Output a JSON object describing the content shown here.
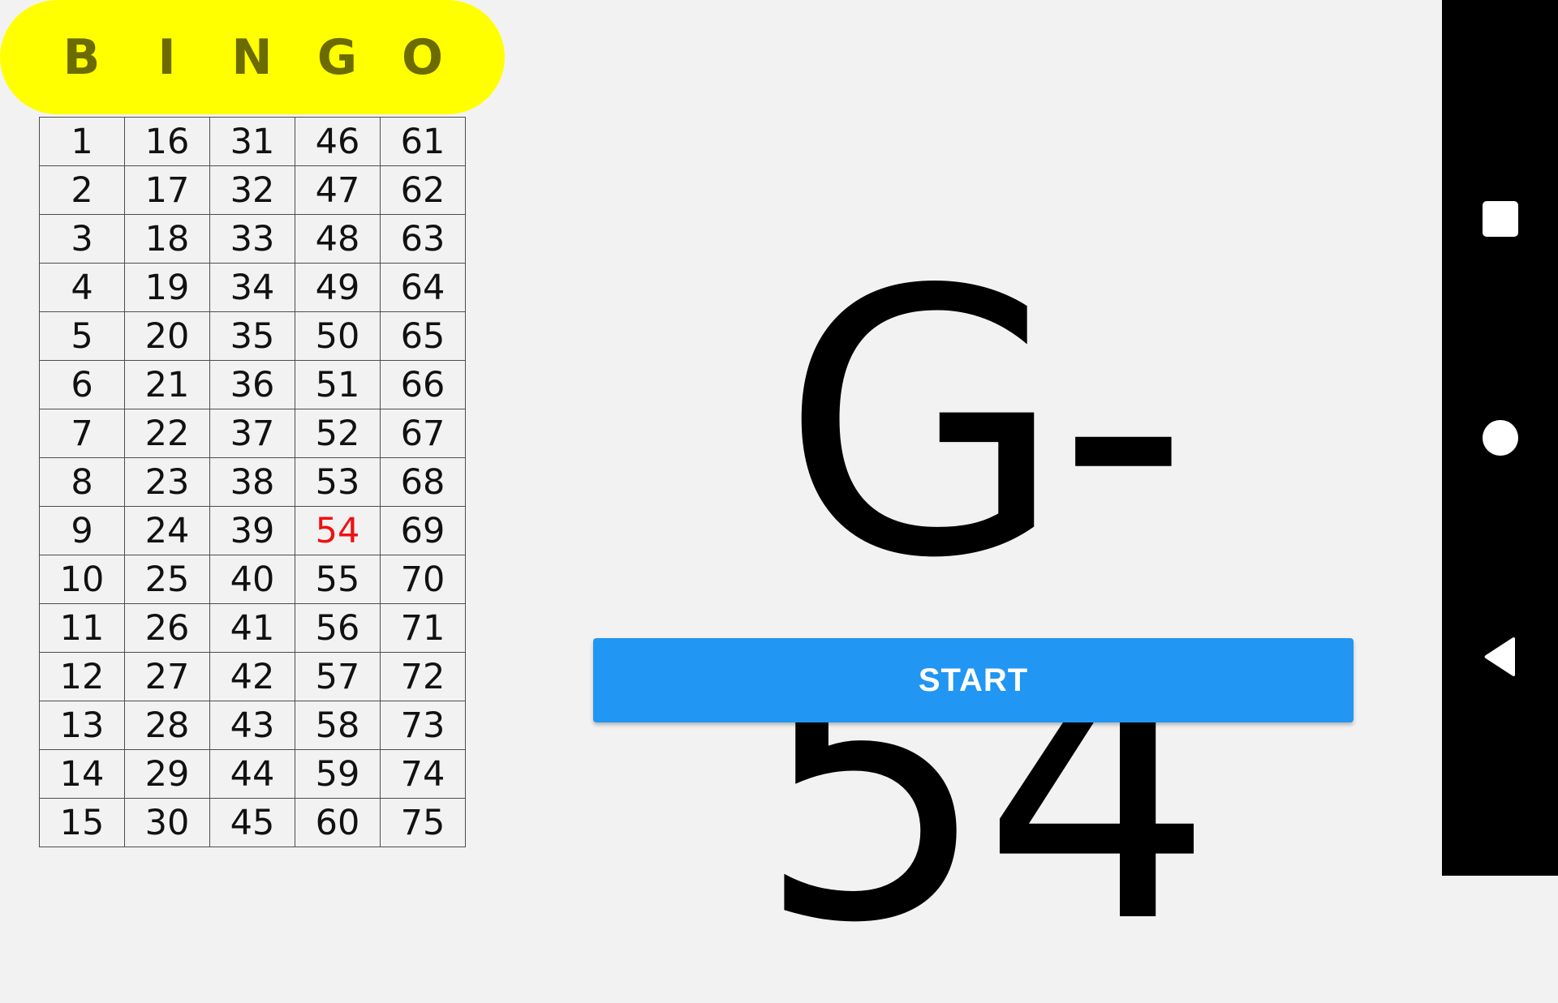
{
  "header": {
    "letters": [
      "B",
      "I",
      "N",
      "G",
      "O"
    ],
    "background": "#ffff00",
    "text_color": "#6b6b00"
  },
  "board": {
    "called_color": "#ee1111",
    "rows": [
      [
        {
          "v": "1"
        },
        {
          "v": "16"
        },
        {
          "v": "31"
        },
        {
          "v": "46"
        },
        {
          "v": "61"
        }
      ],
      [
        {
          "v": "2"
        },
        {
          "v": "17"
        },
        {
          "v": "32"
        },
        {
          "v": "47"
        },
        {
          "v": "62"
        }
      ],
      [
        {
          "v": "3"
        },
        {
          "v": "18"
        },
        {
          "v": "33"
        },
        {
          "v": "48"
        },
        {
          "v": "63"
        }
      ],
      [
        {
          "v": "4"
        },
        {
          "v": "19"
        },
        {
          "v": "34"
        },
        {
          "v": "49"
        },
        {
          "v": "64"
        }
      ],
      [
        {
          "v": "5"
        },
        {
          "v": "20"
        },
        {
          "v": "35"
        },
        {
          "v": "50"
        },
        {
          "v": "65"
        }
      ],
      [
        {
          "v": "6"
        },
        {
          "v": "21"
        },
        {
          "v": "36"
        },
        {
          "v": "51"
        },
        {
          "v": "66"
        }
      ],
      [
        {
          "v": "7"
        },
        {
          "v": "22"
        },
        {
          "v": "37"
        },
        {
          "v": "52"
        },
        {
          "v": "67"
        }
      ],
      [
        {
          "v": "8"
        },
        {
          "v": "23"
        },
        {
          "v": "38"
        },
        {
          "v": "53"
        },
        {
          "v": "68"
        }
      ],
      [
        {
          "v": "9"
        },
        {
          "v": "24"
        },
        {
          "v": "39"
        },
        {
          "v": "54",
          "called": true
        },
        {
          "v": "69"
        }
      ],
      [
        {
          "v": "10"
        },
        {
          "v": "25"
        },
        {
          "v": "40"
        },
        {
          "v": "55"
        },
        {
          "v": "70"
        }
      ],
      [
        {
          "v": "11"
        },
        {
          "v": "26"
        },
        {
          "v": "41"
        },
        {
          "v": "56"
        },
        {
          "v": "71"
        }
      ],
      [
        {
          "v": "12"
        },
        {
          "v": "27"
        },
        {
          "v": "42"
        },
        {
          "v": "57"
        },
        {
          "v": "72"
        }
      ],
      [
        {
          "v": "13"
        },
        {
          "v": "28"
        },
        {
          "v": "43"
        },
        {
          "v": "58"
        },
        {
          "v": "73"
        }
      ],
      [
        {
          "v": "14"
        },
        {
          "v": "29"
        },
        {
          "v": "44"
        },
        {
          "v": "59"
        },
        {
          "v": "74"
        }
      ],
      [
        {
          "v": "15"
        },
        {
          "v": "30"
        },
        {
          "v": "45"
        },
        {
          "v": "60"
        },
        {
          "v": "75"
        }
      ]
    ]
  },
  "current_call": "G-54",
  "start_button": {
    "label": "START",
    "color": "#2196f3"
  },
  "nav_bar": {
    "background": "#000000",
    "icons": [
      "recents-square-icon",
      "home-circle-icon",
      "back-triangle-icon"
    ]
  }
}
